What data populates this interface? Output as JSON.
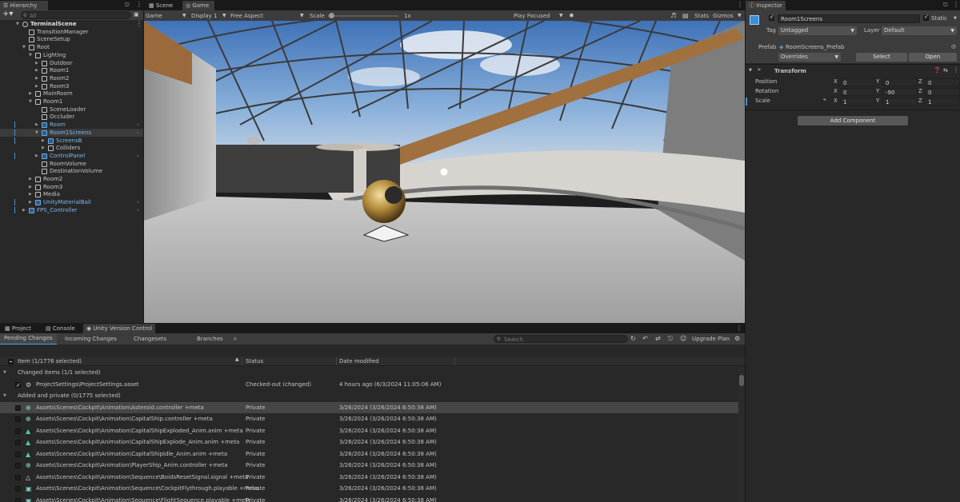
{
  "hierarchy": {
    "tab": "Hierarchy",
    "search_placeholder": "All",
    "items": [
      {
        "label": "TerminalScene",
        "indent": 0,
        "fold": "open",
        "kind": "scene"
      },
      {
        "label": "TransitionManager",
        "indent": 1,
        "fold": "",
        "kind": "obj"
      },
      {
        "label": "SceneSetup",
        "indent": 1,
        "fold": "",
        "kind": "obj"
      },
      {
        "label": "Root",
        "indent": 1,
        "fold": "open",
        "kind": "obj"
      },
      {
        "label": "Lighting",
        "indent": 2,
        "fold": "open",
        "kind": "obj"
      },
      {
        "label": "Outdoor",
        "indent": 3,
        "fold": "closed",
        "kind": "obj"
      },
      {
        "label": "Room1",
        "indent": 3,
        "fold": "closed",
        "kind": "obj"
      },
      {
        "label": "Room2",
        "indent": 3,
        "fold": "closed",
        "kind": "obj"
      },
      {
        "label": "Room3",
        "indent": 3,
        "fold": "closed",
        "kind": "obj"
      },
      {
        "label": "MainRoom",
        "indent": 2,
        "fold": "closed",
        "kind": "obj"
      },
      {
        "label": "Room1",
        "indent": 2,
        "fold": "open",
        "kind": "obj"
      },
      {
        "label": "SceneLoader",
        "indent": 3,
        "fold": "",
        "kind": "obj"
      },
      {
        "label": "Occluder",
        "indent": 3,
        "fold": "",
        "kind": "obj"
      },
      {
        "label": "Room",
        "indent": 3,
        "fold": "closed",
        "kind": "prefab",
        "more": true
      },
      {
        "label": "Room1Screens",
        "indent": 3,
        "fold": "open",
        "kind": "prefab",
        "selected": true,
        "more": true
      },
      {
        "label": "ScreensB",
        "indent": 4,
        "fold": "closed",
        "kind": "prefab"
      },
      {
        "label": "Colliders",
        "indent": 4,
        "fold": "closed",
        "kind": "obj"
      },
      {
        "label": "ControlPanel",
        "indent": 3,
        "fold": "closed",
        "kind": "prefab",
        "more": true
      },
      {
        "label": "RoomVolume",
        "indent": 3,
        "fold": "",
        "kind": "obj"
      },
      {
        "label": "DestinationVolume",
        "indent": 3,
        "fold": "",
        "kind": "obj"
      },
      {
        "label": "Room2",
        "indent": 2,
        "fold": "closed",
        "kind": "obj"
      },
      {
        "label": "Room3",
        "indent": 2,
        "fold": "closed",
        "kind": "obj"
      },
      {
        "label": "Media",
        "indent": 2,
        "fold": "closed",
        "kind": "obj"
      },
      {
        "label": "UnityMaterialBall",
        "indent": 2,
        "fold": "closed",
        "kind": "prefab",
        "more": true
      },
      {
        "label": "FPS_Controller",
        "indent": 1,
        "fold": "closed",
        "kind": "prefab",
        "more": true
      }
    ]
  },
  "view": {
    "tabs": {
      "scene": "Scene",
      "game": "Game"
    },
    "game_dropdown": "Game",
    "display_dropdown": "Display 1",
    "aspect_dropdown": "Free Aspect",
    "scale_label": "Scale",
    "scale_value": "1x",
    "play_mode": "Play Focused",
    "stats": "Stats",
    "gizmos": "Gizmos"
  },
  "inspector": {
    "tab": "Inspector",
    "object_name": "Room1Screens",
    "static_label": "Static",
    "tag_label": "Tag",
    "tag_value": "Untagged",
    "layer_label": "Layer",
    "layer_value": "Default",
    "prefab_label": "Prefab",
    "prefab_value": "RoomScreens_Prefab",
    "overrides": "Overrides",
    "select": "Select",
    "open": "Open",
    "transform_title": "Transform",
    "position_label": "Position",
    "rotation_label": "Rotation",
    "scale_label": "Scale",
    "axis": {
      "x": "X",
      "y": "Y",
      "z": "Z"
    },
    "position": {
      "x": "0",
      "y": "0",
      "z": "0"
    },
    "rotation": {
      "x": "0",
      "y": "-90",
      "z": "0"
    },
    "scale": {
      "x": "1",
      "y": "1",
      "z": "1"
    },
    "add_component": "Add Component"
  },
  "bottom": {
    "tabs": {
      "project": "Project",
      "console": "Console",
      "uvc": "Unity Version Control"
    },
    "subtabs": {
      "pending": "Pending Changes",
      "incoming": "Incoming Changes",
      "changesets": "Changesets",
      "branches": "Branches"
    },
    "search_placeholder": "Search",
    "upgrade": "Upgrade Plan",
    "columns": {
      "item": "Item (1/1776 selected)",
      "status": "Status",
      "date": "Date modified"
    },
    "changed_group": "Changed items (1/1 selected)",
    "changed_rows": [
      {
        "path": "ProjectSettings\\ProjectSettings.asset",
        "status": "Checked-out (changed)",
        "date": "4 hours ago (6/3/2024 11:05:06 AM)"
      }
    ],
    "added_group": "Added and private (0/1775 selected)",
    "added_rows": [
      {
        "path": "Assets\\Scenes\\Cockpit\\Animation\\Asteroid.controller +meta",
        "status": "Private",
        "date": "3/26/2024 (3/26/2024 6:50:38 AM)",
        "icon": "controller"
      },
      {
        "path": "Assets\\Scenes\\Cockpit\\Animation\\CapitalShip.controller +meta",
        "status": "Private",
        "date": "3/26/2024 (3/26/2024 6:50:38 AM)",
        "icon": "controller"
      },
      {
        "path": "Assets\\Scenes\\Cockpit\\Animation\\CapitalShipExploded_Anim.anim +meta",
        "status": "Private",
        "date": "3/26/2024 (3/26/2024 6:50:38 AM)",
        "icon": "anim"
      },
      {
        "path": "Assets\\Scenes\\Cockpit\\Animation\\CapitalShipExplode_Anim.anim +meta",
        "status": "Private",
        "date": "3/26/2024 (3/26/2024 6:50:38 AM)",
        "icon": "anim"
      },
      {
        "path": "Assets\\Scenes\\Cockpit\\Animation\\CapitalShipIdle_Anim.anim +meta",
        "status": "Private",
        "date": "3/26/2024 (3/26/2024 6:50:38 AM)",
        "icon": "anim"
      },
      {
        "path": "Assets\\Scenes\\Cockpit\\Animation\\PlayerShip_Anim.controller +meta",
        "status": "Private",
        "date": "3/26/2024 (3/26/2024 6:50:38 AM)",
        "icon": "controller"
      },
      {
        "path": "Assets\\Scenes\\Cockpit\\Animation\\Sequence\\BoidsResetSignal.signal +meta",
        "status": "Private",
        "date": "3/26/2024 (3/26/2024 6:50:38 AM)",
        "icon": "signal"
      },
      {
        "path": "Assets\\Scenes\\Cockpit\\Animation\\Sequence\\CockpitFlythrough.playable +meta",
        "status": "Private",
        "date": "3/26/2024 (3/26/2024 6:50:38 AM)",
        "icon": "playable"
      },
      {
        "path": "Assets\\Scenes\\Cockpit\\Animation\\Sequence\\FlightSequence.playable +meta",
        "status": "Private",
        "date": "3/26/2024 (3/26/2024 6:50:38 AM)",
        "icon": "playable"
      }
    ]
  }
}
